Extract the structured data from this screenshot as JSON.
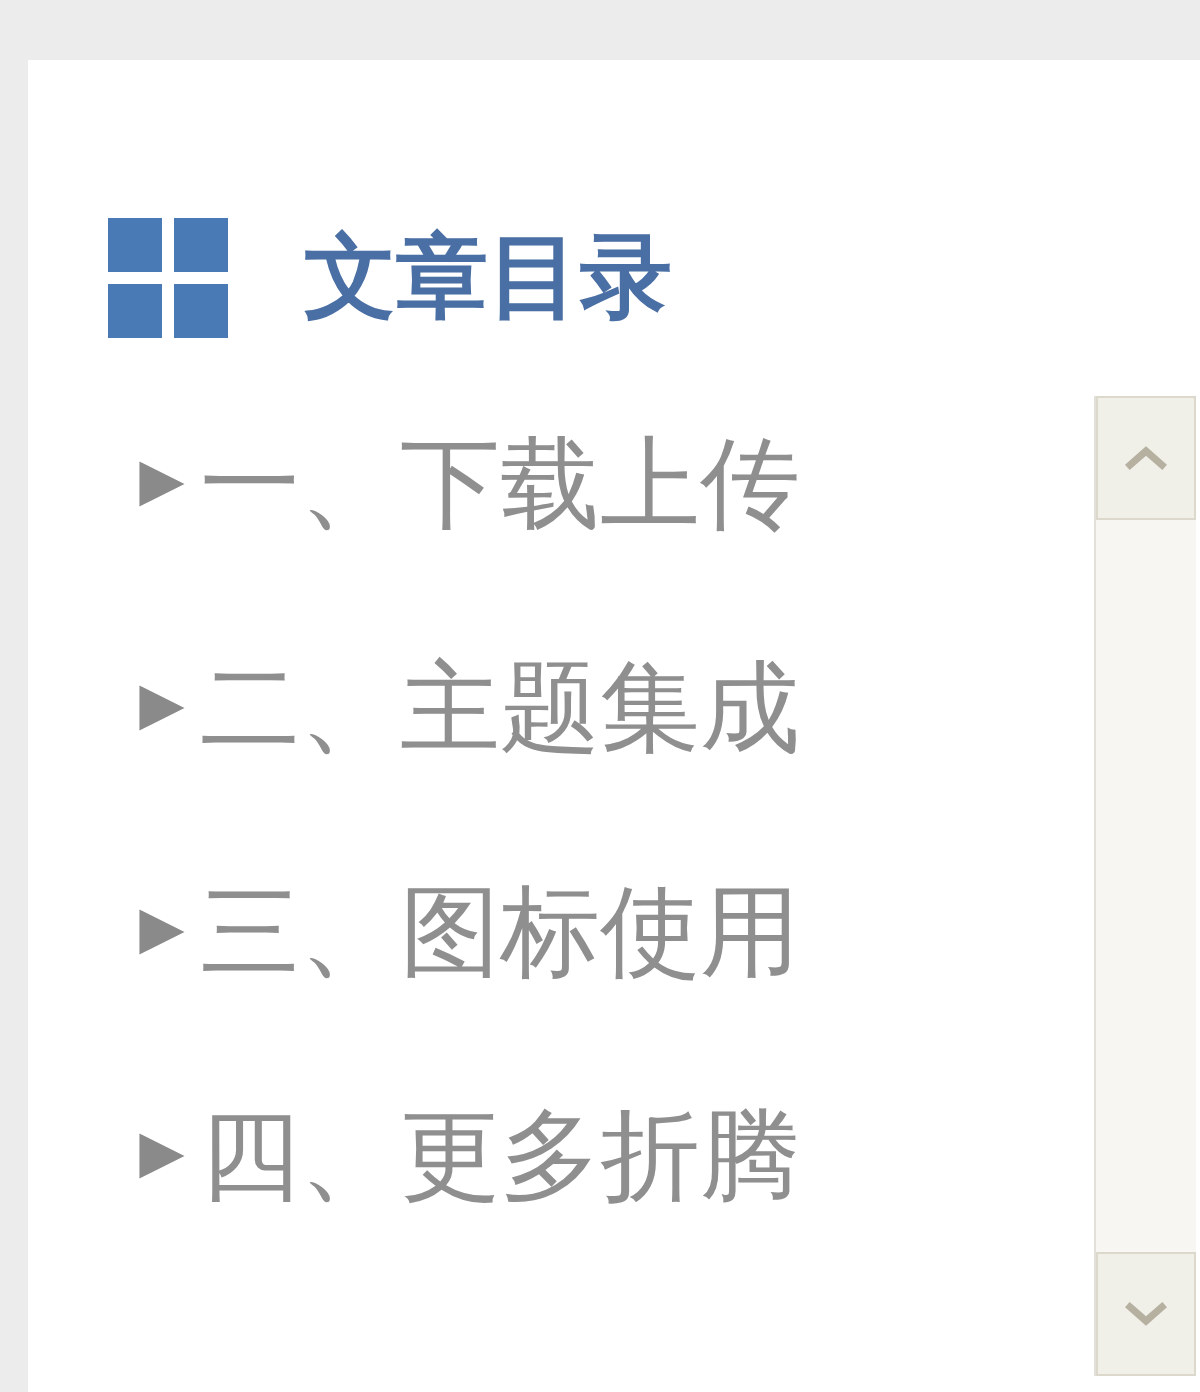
{
  "title": "文章目录",
  "items": [
    {
      "label": "一、下载上传"
    },
    {
      "label": "二、主题集成"
    },
    {
      "label": "三、图标使用"
    },
    {
      "label": "四、更多折腾"
    }
  ]
}
